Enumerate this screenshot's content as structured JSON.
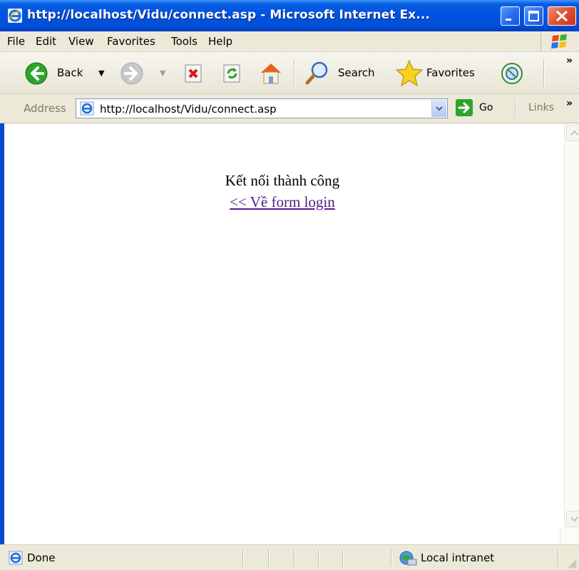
{
  "window": {
    "title": "http://localhost/Vidu/connect.asp - Microsoft Internet Ex..."
  },
  "menu": {
    "items": [
      "File",
      "Edit",
      "View",
      "Favorites",
      "Tools",
      "Help"
    ]
  },
  "toolbar": {
    "back_label": "Back",
    "search_label": "Search",
    "favorites_label": "Favorites",
    "overflow": "»"
  },
  "address": {
    "label": "Address",
    "url": "http://localhost/Vidu/connect.asp",
    "go_label": "Go",
    "links_label": "Links",
    "links_overflow": "»"
  },
  "page": {
    "message": "Kết nối thành công",
    "back_link": "<< Về form login"
  },
  "status": {
    "text": "Done",
    "zone": "Local intranet"
  },
  "icons": {
    "ie": "ie-icon",
    "minimize": "minimize-icon",
    "maximize": "maximize-icon",
    "close": "close-icon",
    "back": "back-arrow-icon",
    "forward": "forward-arrow-icon",
    "stop": "stop-icon",
    "refresh": "refresh-icon",
    "home": "home-icon",
    "search": "search-icon",
    "favorites": "star-icon",
    "media": "media-icon",
    "go": "go-arrow-icon"
  },
  "colors": {
    "titlebar": "#0054e3",
    "chrome": "#ece9d8",
    "visited_link": "#551a8b"
  }
}
